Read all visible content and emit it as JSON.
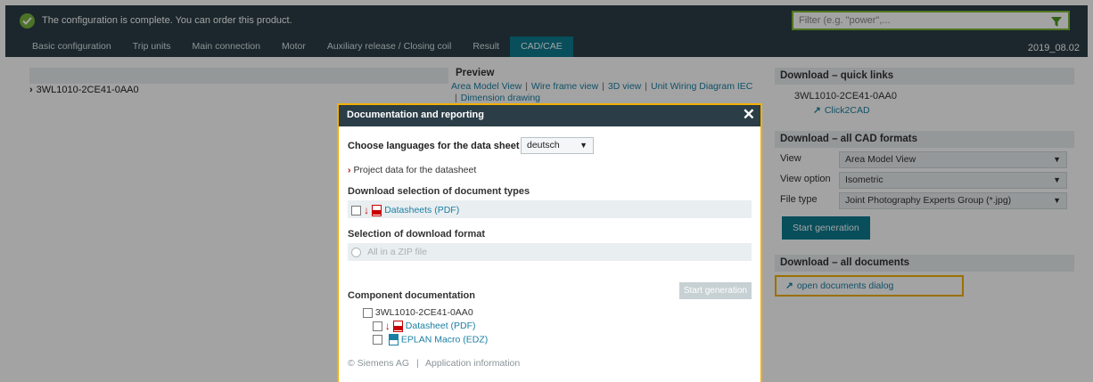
{
  "topbar": {
    "message": "The configuration is complete. You can order this product.",
    "filter_placeholder": "Filter (e.g. \"power\",...",
    "version": "2019_08.02",
    "tabs": [
      {
        "label": "Basic configuration",
        "active": false
      },
      {
        "label": "Trip units",
        "active": false
      },
      {
        "label": "Main connection",
        "active": false
      },
      {
        "label": "Motor",
        "active": false
      },
      {
        "label": "Auxiliary release / Closing coil",
        "active": false
      },
      {
        "label": "Result",
        "active": false
      },
      {
        "label": "CAD/CAE",
        "active": true
      }
    ]
  },
  "left": {
    "product": "3WL1010-2CE41-0AA0"
  },
  "preview": {
    "title": "Preview",
    "links": [
      "Area Model View",
      "Wire frame view",
      "3D view",
      "Unit Wiring Diagram IEC",
      "Dimension drawing"
    ]
  },
  "right": {
    "quick_links_title": "Download – quick links",
    "quick_product": "3WL1010-2CE41-0AA0",
    "click2cad": "Click2CAD",
    "cad_formats_title": "Download – all CAD formats",
    "view_label": "View",
    "view_value": "Area Model View",
    "view_option_label": "View option",
    "view_option_value": "Isometric",
    "file_type_label": "File type",
    "file_type_value": "Joint Photography Experts Group (*.jpg)",
    "start_generation": "Start generation",
    "all_documents_title": "Download – all documents",
    "open_documents_dialog": "open documents dialog"
  },
  "modal": {
    "title": "Documentation and reporting",
    "close": "✕",
    "lang_label": "Choose languages for the data sheet",
    "lang_value": "deutsch",
    "project_data": "Project data for the datasheet",
    "doc_types_title": "Download selection of document types",
    "datasheets": "Datasheets (PDF)",
    "format_title": "Selection of download format",
    "zip_option": "All in a ZIP file",
    "start_generation": "Start generation",
    "component_title": "Component documentation",
    "component_product": "3WL1010-2CE41-0AA0",
    "datasheet": "Datasheet (PDF)",
    "eplan_macro": "EPLAN Macro (EDZ)",
    "footer_company": "© Siemens AG",
    "footer_info": "Application information"
  },
  "colors": {
    "topbar_bg": "#2b3d46",
    "accent_teal": "#0d7b8f",
    "link_blue": "#1a7fa3",
    "highlight_yellow": "#f2b000",
    "success_green": "#78b43c"
  }
}
